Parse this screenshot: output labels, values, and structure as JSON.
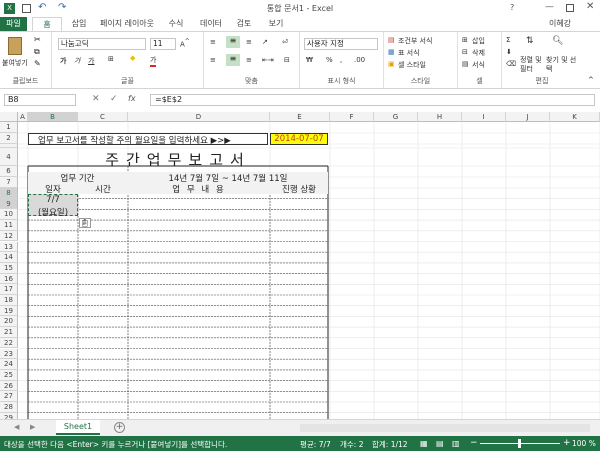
{
  "window": {
    "title": "통합 문서1 - Excel",
    "user": "이혜강"
  },
  "tabs": [
    "파일",
    "홈",
    "삽입",
    "페이지 레이아웃",
    "수식",
    "데이터",
    "검토",
    "보기"
  ],
  "ribbon": {
    "clipboard": {
      "paste": "붙여넣기",
      "label": "클립보드"
    },
    "font": {
      "name": "나눔고딕",
      "size": "11",
      "label": "글꼴"
    },
    "align": {
      "label": "맞춤"
    },
    "number": {
      "format": "사용자 지정",
      "label": "표시 형식",
      "percent": "%"
    },
    "styles": {
      "cond": "조건부 서식",
      "table": "표 서식",
      "cell": "셀 스타일",
      "label": "스타일"
    },
    "cells": {
      "insert": "삽입",
      "delete": "삭제",
      "format": "서식",
      "label": "셀"
    },
    "edit": {
      "sort": "정렬 및 필터",
      "find": "찾기 및 선택",
      "label": "편집"
    }
  },
  "formula_bar": {
    "name_box": "B8",
    "formula": "=$E$2"
  },
  "columns": [
    "A",
    "B",
    "C",
    "D",
    "E",
    "F",
    "G",
    "H",
    "I",
    "J",
    "K"
  ],
  "rows": [
    "1",
    "2",
    "3",
    "4",
    "6",
    "7",
    "8",
    "9",
    "10",
    "11",
    "12",
    "13",
    "14",
    "15",
    "16",
    "17",
    "18",
    "19",
    "20",
    "21",
    "22",
    "23",
    "24",
    "25",
    "26",
    "27",
    "28",
    "29",
    "30",
    "31",
    "32"
  ],
  "sheet": {
    "instruction": "업무 보고서를 작성할 주의 월요일을 입력하세요  ▶>▶",
    "date": "2014-07-07",
    "title": "주간업무보고서",
    "period_label": "업무 기간",
    "period": "14년 7월 7일 ~ 14년 7월 11일",
    "h_date": "일자",
    "h_time": "시간",
    "h_content": "업 무 내 용",
    "h_status": "진행 상황",
    "b8": "7/7",
    "b9": "(월요일)"
  },
  "sheet_tabs": [
    "Sheet1"
  ],
  "status": {
    "message": "대상을 선택한 다음 <Enter> 키를 누르거나 [붙여넣기]를 선택합니다.",
    "avg": "평균: 7/7",
    "count": "개수: 2",
    "sum": "합계: 1/12",
    "zoom": "100 %"
  }
}
